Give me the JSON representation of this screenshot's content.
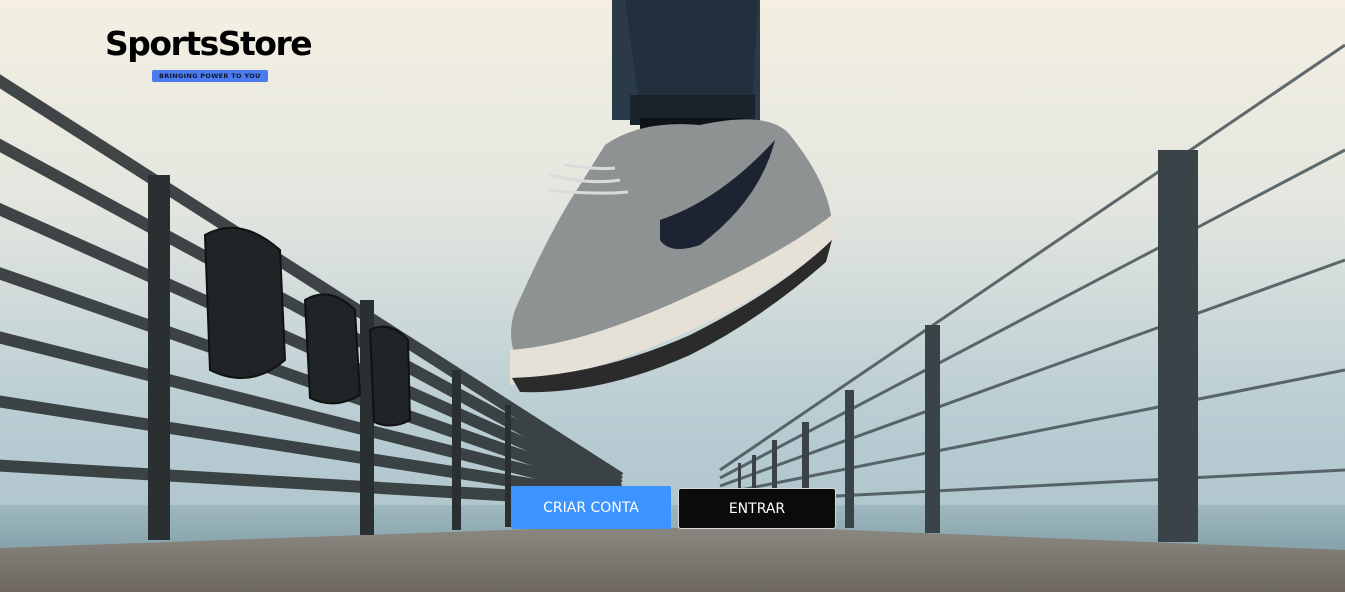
{
  "brand": {
    "name": "SportsStore",
    "tagline": "BRINGING POWER TO YOU",
    "tagline_color": "#4a7cf0"
  },
  "hero": {
    "image": "sneaker-jump-on-pier-photo"
  },
  "actions": {
    "create_account_label": "CRIAR CONTA",
    "login_label": "ENTRAR",
    "primary_color": "#3d93ff",
    "secondary_color": "#0b0b0b"
  }
}
